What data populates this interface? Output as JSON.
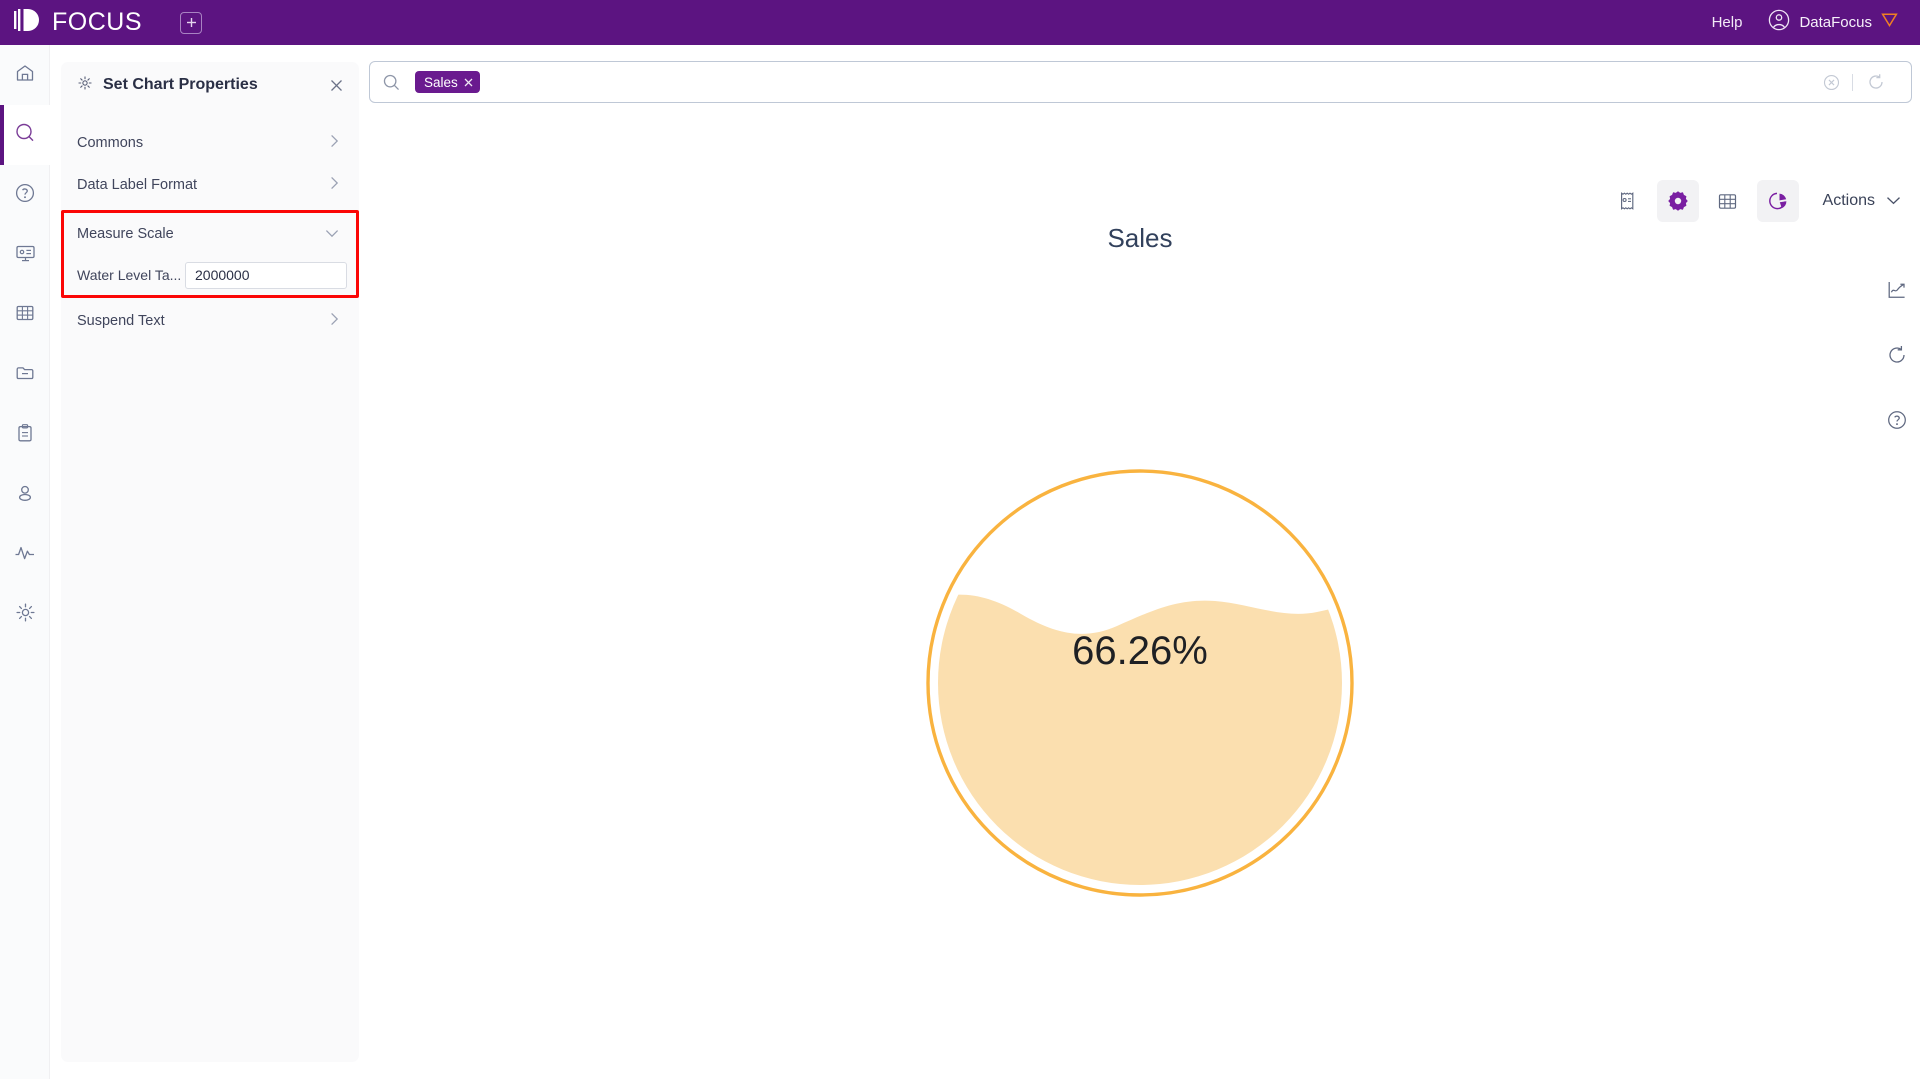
{
  "header": {
    "brand": "FOCUS",
    "brand_logo_icon": "focus-logo-icon",
    "add_tab_icon": "plus-square-icon",
    "help_label": "Help",
    "user_name": "DataFocus",
    "user_avatar_icon": "user-circle-icon",
    "user_badge_icon": "shield-badge-icon",
    "bg_color": "#5C1481"
  },
  "icon_rail": {
    "items": [
      {
        "name": "home-icon",
        "label": "Home",
        "active": false
      },
      {
        "name": "search-icon",
        "label": "Search",
        "active": true
      },
      {
        "name": "question-circle-icon",
        "label": "Help",
        "active": false
      },
      {
        "name": "presentation-icon",
        "label": "Dashboard",
        "active": false
      },
      {
        "name": "table-grid-icon",
        "label": "Data",
        "active": false
      },
      {
        "name": "folder-icon",
        "label": "Folder",
        "active": false
      },
      {
        "name": "clipboard-icon",
        "label": "Tasks",
        "active": false
      },
      {
        "name": "user-icon",
        "label": "User",
        "active": false
      },
      {
        "name": "pulse-icon",
        "label": "Monitor",
        "active": false
      },
      {
        "name": "gear-icon",
        "label": "Settings",
        "active": false
      }
    ],
    "active_indicator_color": "#5C1481"
  },
  "properties_panel": {
    "title": "Set Chart Properties",
    "title_icon": "gear-outline-icon",
    "close_icon": "close-icon",
    "rows": [
      {
        "label": "Commons",
        "state": "collapsed",
        "chevron": "chevron-right-icon"
      },
      {
        "label": "Data Label Format",
        "state": "collapsed",
        "chevron": "chevron-right-icon"
      },
      {
        "label": "Suspend Text",
        "state": "collapsed",
        "chevron": "chevron-right-icon"
      }
    ],
    "measure_scale": {
      "label": "Measure Scale",
      "state": "expanded",
      "chevron": "chevron-down-icon",
      "highlighted": true,
      "highlight_color": "#FB0606",
      "field_label": "Water Level Ta...",
      "field_value": "2000000",
      "field_placeholder": ""
    }
  },
  "search": {
    "search_icon": "search-icon",
    "placeholder": "",
    "chips": [
      {
        "label": "Sales",
        "remove_icon": "close-icon",
        "color": "#6A1A8F"
      }
    ],
    "clear_icon": "clear-circle-icon",
    "reload_icon": "refresh-icon"
  },
  "chart_toolbar": {
    "buttons": [
      {
        "name": "receipt-icon",
        "label": "Answer",
        "selected": false
      },
      {
        "name": "gear-filled-icon",
        "label": "Chart Properties",
        "selected": true
      },
      {
        "name": "table-icon",
        "label": "Table",
        "selected": false
      },
      {
        "name": "pie-chart-icon",
        "label": "Chart Type",
        "selected": true
      }
    ],
    "actions_label": "Actions",
    "actions_chevron": "chevron-down-icon"
  },
  "right_strip": {
    "buttons": [
      {
        "name": "trend-chart-icon",
        "label": "Chart"
      },
      {
        "name": "reset-icon",
        "label": "Reset"
      },
      {
        "name": "question-circle-icon",
        "label": "Help"
      }
    ]
  },
  "chart_data": {
    "type": "pie",
    "visual": "liquid-fill-water-level-gauge",
    "title": "Sales",
    "value_label": "66.26%",
    "value_percent": 66.26,
    "target": 2000000,
    "measure": "Sales",
    "fill_color": "#FBDFAF",
    "ring_color": "#F9B33F",
    "background_color": "#FFFFFF",
    "label_color": "#1E2024",
    "grid": false,
    "legend": "none",
    "xlabel": "",
    "ylabel": ""
  }
}
